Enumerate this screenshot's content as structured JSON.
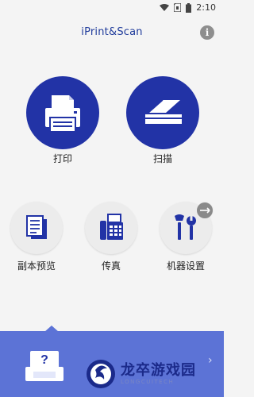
{
  "status_bar": {
    "time": "2:10"
  },
  "header": {
    "title": "iPrint&Scan",
    "info_glyph": "i"
  },
  "primary_actions": [
    {
      "label": "打印",
      "icon": "printer-icon"
    },
    {
      "label": "扫描",
      "icon": "scanner-icon"
    }
  ],
  "secondary_actions": [
    {
      "label": "副本预览",
      "icon": "copy-preview-icon"
    },
    {
      "label": "传真",
      "icon": "fax-icon"
    },
    {
      "label": "机器设置",
      "icon": "tools-icon"
    }
  ],
  "bottom_panel": {
    "device_status_glyph": "?"
  },
  "watermark": {
    "main": "龙卒游戏园",
    "sub": "LONGCUITECH"
  },
  "colors": {
    "primary": "#2233a6",
    "accent_panel": "#5c73d6",
    "background": "#f4f4f4"
  }
}
